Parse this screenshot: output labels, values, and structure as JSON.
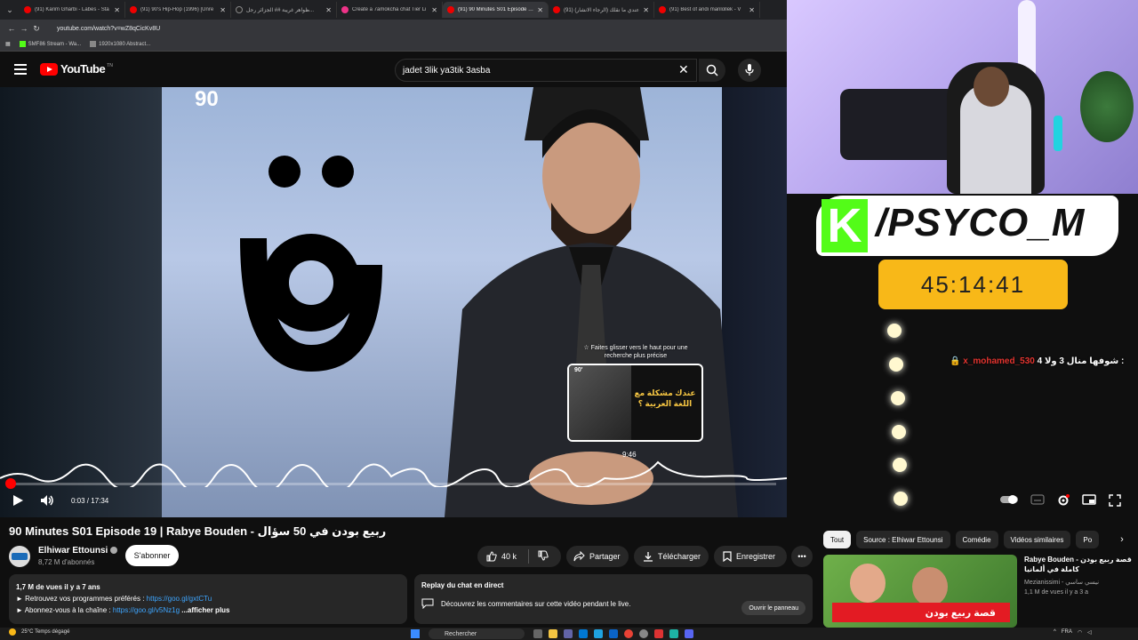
{
  "browser": {
    "tabs": [
      {
        "title": "(91) Karim Gharbi - Labes - Sta",
        "active": false,
        "icon": "youtube"
      },
      {
        "title": "(91) 90's Hip-Hop (1996) [Unre",
        "active": false,
        "icon": "youtube"
      },
      {
        "title": "ظواهر غريبة ## الجزائر رجل...",
        "active": false,
        "icon": "tiktok"
      },
      {
        "title": "Create a 7amokcha chat Tier Li",
        "active": false,
        "icon": "tierlist"
      },
      {
        "title": "(91) 90 Minutes S01 Episode 19",
        "active": true,
        "icon": "youtube"
      },
      {
        "title": "(91) عندي ما نقلك (الرجاء الانشار)",
        "active": false,
        "icon": "youtube"
      },
      {
        "title": "(91) Best of andi manlollek - V",
        "active": false,
        "icon": "youtube"
      }
    ],
    "url": "youtube.com/watch?v=wZ8qCicKv8U",
    "bookmarks": [
      "SMF86 Stream - Wa...",
      "1920x1080 Abstract..."
    ]
  },
  "youtube": {
    "logo_text": "YouTube",
    "logo_tn": "TN",
    "search_query": "jadet 3lik ya3tik 3asba",
    "player": {
      "channel_watermark": "90",
      "seek_hint": "☆ Faites glisser vers le haut pour une recherche plus précise",
      "preview_time": "9:46",
      "preview_logo": "90'",
      "preview_text": "عندك مشكلة مع اللغة العربية ؟",
      "time_readout": "0:03 / 17:34",
      "progress": 0.003
    },
    "video": {
      "title": "90 Minutes S01 Episode 19 | Rabye Bouden - ربيع بودن في 50 سؤال",
      "channel": "Elhiwar Ettounsi",
      "subscribers": "8,72 M d'abonnés",
      "subscribe_label": "S'abonner",
      "likes": "40 k",
      "share_label": "Partager",
      "download_label": "Télécharger",
      "save_label": "Enregistrer"
    },
    "description": {
      "meta": "1,7 M de vues  il y a 7 ans",
      "line1_prefix": "► Retrouvez vos programmes préférés : ",
      "line1_link": "https://goo.gl/gxtCTu",
      "line2_prefix": "► Abonnez-vous à la chaîne : ",
      "line2_link": "https://goo.gl/v5Nz1g",
      "more": "...afficher plus"
    },
    "chat_replay": {
      "title": "Replay du chat en direct",
      "text": "Découvrez les commentaires sur cette vidéo pendant le live.",
      "button": "Ouvrir le panneau"
    },
    "chips": [
      "Tout",
      "Source : Elhiwar Ettounsi",
      "Comédie",
      "Vidéos similaires",
      "Po"
    ],
    "recommended": {
      "title": "Rabye Bouden - قصة ربيع بودن كاملة في ألمانيا",
      "channel": "Mezianissimi - نيسي ساسي",
      "meta": "1,1 M de vues  il y a 3 a",
      "thumb_caption": "قصة ربيع بودن"
    }
  },
  "overlay": {
    "kick_handle": "/PSYCO_M",
    "kick_letter": "K",
    "timer": "45:14:41",
    "chat_user": "x_mohamed_530",
    "chat_message": "شوفها منال 3 ولا 4 :"
  },
  "taskbar": {
    "temp": "25°C",
    "weather": "Temps dégagé",
    "search": "Rechercher",
    "lang": "FRA"
  },
  "colors": {
    "yt_red": "#ff0000",
    "kick_green": "#53fc18",
    "timer_yellow": "#f8b818",
    "link_blue": "#3ea6ff"
  }
}
